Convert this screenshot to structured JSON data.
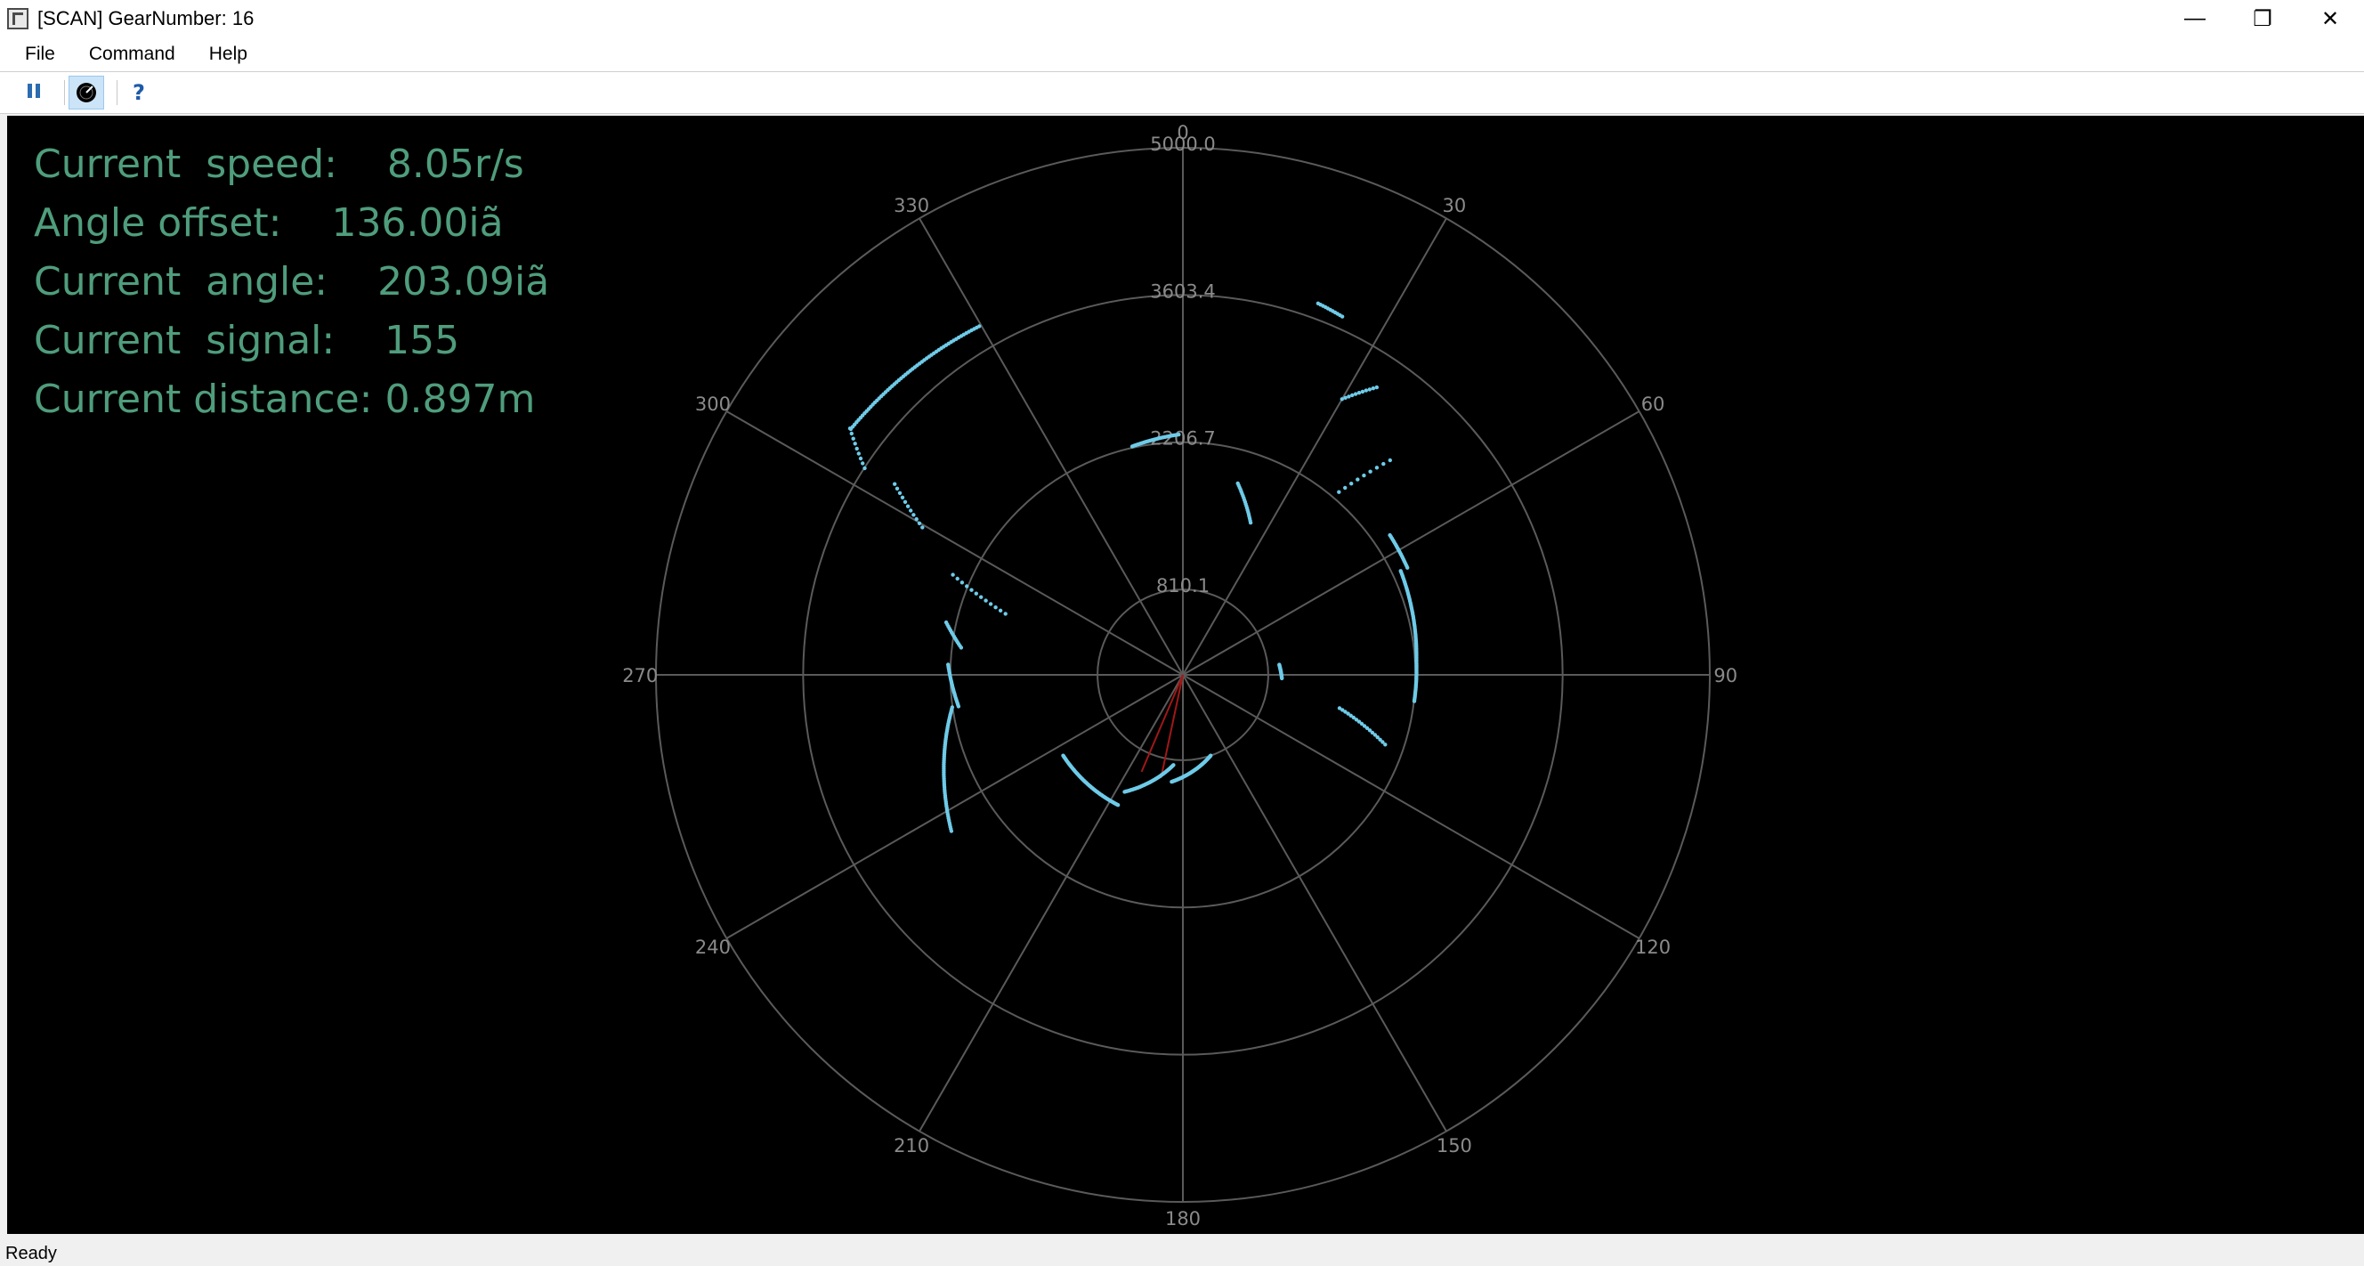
{
  "window": {
    "title": "[SCAN] GearNumber: 16",
    "minimize_glyph": "—",
    "restore_glyph": "❐",
    "close_glyph": "✕"
  },
  "menu": {
    "file": "File",
    "command": "Command",
    "help": "Help"
  },
  "toolbar": {
    "pause_icon": "pause-icon",
    "scan_icon": "radar-scan-icon",
    "help_icon": "help-icon",
    "help_glyph": "?"
  },
  "info": {
    "speed": "Current  speed:    8.05r/s",
    "offset": "Angle offset:    136.00iã",
    "angle": "Current  angle:    203.09iã",
    "signal": "Current  signal:    155",
    "distance": "Current distance: 0.897m"
  },
  "polar_plot": {
    "range_max": 5000.0,
    "ring_labels": [
      "810.1",
      "2206.7",
      "3603.4",
      "5000.0"
    ],
    "ring_values": [
      810.1,
      2206.7,
      3603.4,
      5000.0
    ],
    "angle_labels": [
      "0",
      "30",
      "60",
      "90",
      "120",
      "150",
      "180",
      "210",
      "240",
      "270",
      "300",
      "330"
    ],
    "colors": {
      "grid": "#5a5a5a",
      "label": "#8a8a8a",
      "points": "#6ecbe8",
      "ray": "#a01818"
    },
    "ray_angles": [
      192,
      203.09
    ],
    "scan_segments": [
      {
        "a1": 306.5,
        "a2": 329.7,
        "r1": 3920,
        "r2": 3830
      },
      {
        "a1": 303.0,
        "a2": 306.5,
        "r1": 3600,
        "r2": 3930
      },
      {
        "a1": 299.5,
        "a2": 303.5,
        "r1": 2840,
        "r2": 3280
      },
      {
        "a1": 289.0,
        "a2": 293.5,
        "r1": 1780,
        "r2": 2380
      },
      {
        "a1": 277.0,
        "a2": 282.5,
        "r1": 2120,
        "r2": 2300
      },
      {
        "a1": 262.0,
        "a2": 272.5,
        "r1": 2150,
        "r2": 2230
      },
      {
        "a1": 236.0,
        "a2": 262.0,
        "r1": 2650,
        "r2": 2210
      },
      {
        "a1": 206.5,
        "a2": 236.0,
        "r1": 1380,
        "r2": 1370
      },
      {
        "a1": 186.0,
        "a2": 206.5,
        "r1": 860,
        "r2": 1240
      },
      {
        "a1": 161.0,
        "a2": 186.0,
        "r1": 810,
        "r2": 1020
      },
      {
        "a1": 347.5,
        "a2": 359.0,
        "r1": 2220,
        "r2": 2280
      },
      {
        "a1": 16.0,
        "a2": 24.0,
        "r1": 1890,
        "r2": 1580
      },
      {
        "a1": 20.0,
        "a2": 24.0,
        "r1": 3750,
        "r2": 3720
      },
      {
        "a1": 30.0,
        "a2": 34.0,
        "r1": 3020,
        "r2": 3290
      },
      {
        "a1": 40.5,
        "a2": 44.0,
        "r1": 2280,
        "r2": 2830
      },
      {
        "a1": 56.0,
        "a2": 64.5,
        "r1": 2370,
        "r2": 2360
      },
      {
        "a1": 64.5,
        "a2": 86.5,
        "r1": 2290,
        "r2": 2220
      },
      {
        "a1": 86.5,
        "a2": 96.5,
        "r1": 2220,
        "r2": 2210
      },
      {
        "a1": 102.0,
        "a2": 109.0,
        "r1": 1520,
        "r2": 2030
      },
      {
        "a1": 84.0,
        "a2": 92.0,
        "r1": 920,
        "r2": 940
      }
    ]
  },
  "status": {
    "text": "Ready"
  }
}
